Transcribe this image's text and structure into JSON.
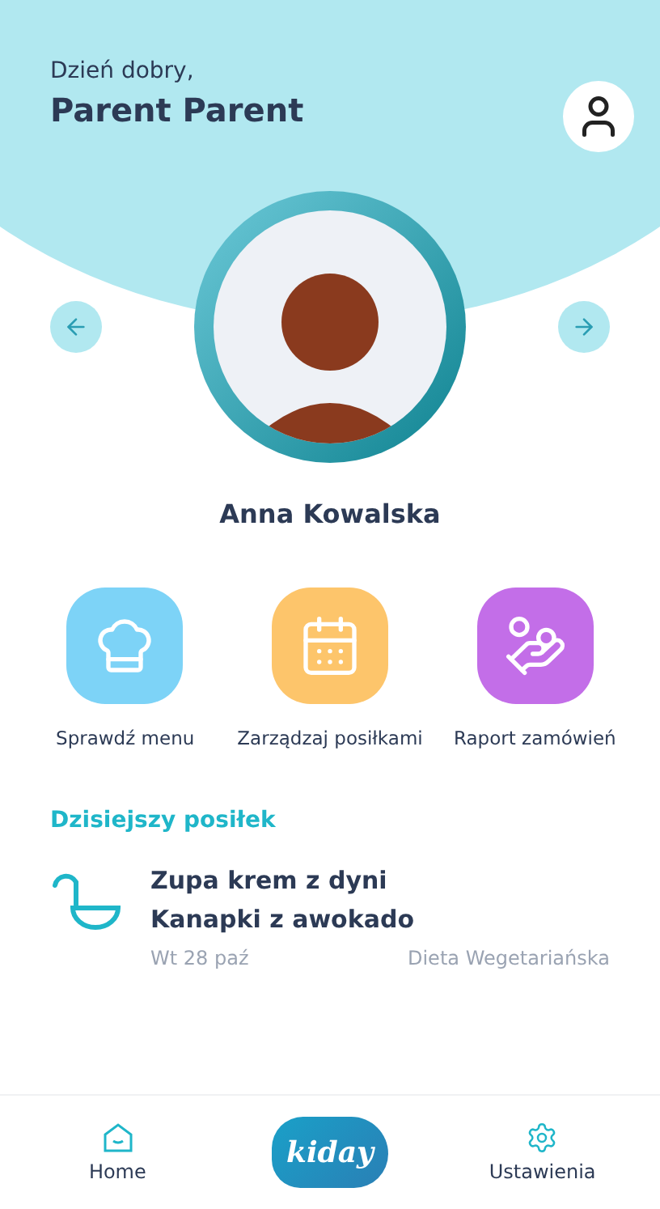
{
  "header": {
    "greeting": "Dzień dobry,",
    "user_name": "Parent Parent"
  },
  "child": {
    "name": "Anna Kowalska"
  },
  "actions": [
    {
      "kind": "menu",
      "label": "Sprawdź menu",
      "color": "#7dd3f7"
    },
    {
      "kind": "meals",
      "label": "Zarządzaj posiłkami",
      "color": "#fdc56b"
    },
    {
      "kind": "report",
      "label": "Raport zamówień",
      "color": "#c36ee8"
    }
  ],
  "today_meal": {
    "title": "Dzisiejszy posiłek",
    "items": [
      "Zupa krem z dyni",
      "Kanapki z awokado"
    ],
    "date": "Wt 28 paź",
    "diet": "Dieta Wegetariańska"
  },
  "bottom_nav": [
    {
      "kind": "home",
      "label": "Home"
    },
    {
      "kind": "logo",
      "label": "kiday"
    },
    {
      "kind": "settings",
      "label": "Ustawienia"
    }
  ]
}
